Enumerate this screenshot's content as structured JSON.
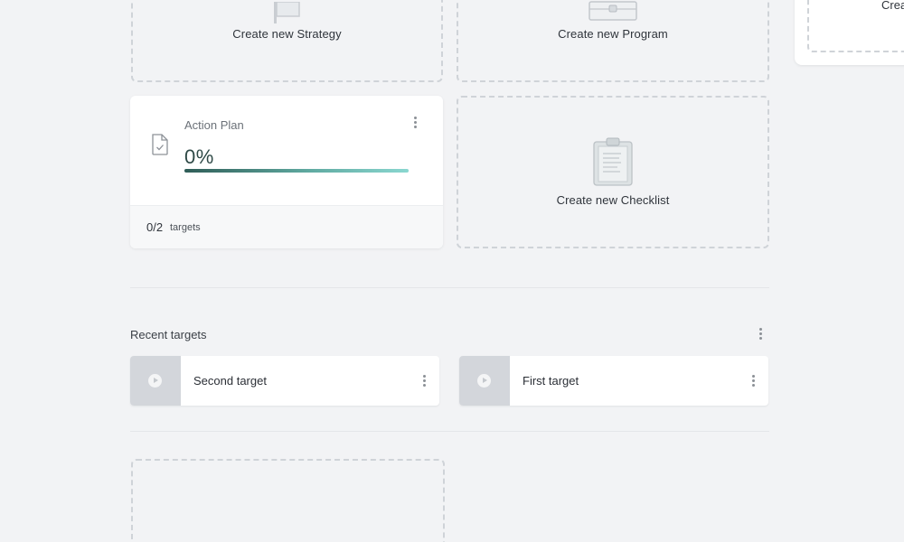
{
  "create_tiles": {
    "strategy": {
      "label": "Create new Strategy",
      "icon": "flag-icon"
    },
    "program": {
      "label": "Create new Program",
      "icon": "briefcase-icon"
    },
    "checklist": {
      "label": "Create new Checklist",
      "icon": "clipboard-icon"
    },
    "partial": {
      "label": "Crea"
    }
  },
  "action_plan": {
    "title": "Action Plan",
    "percent_text": "0%",
    "progress_fraction": 0.0,
    "count": "0/2",
    "count_label": "targets",
    "icon": "document-check-icon"
  },
  "recent_targets": {
    "title": "Recent targets",
    "items": [
      {
        "name": "Second target"
      },
      {
        "name": "First target"
      }
    ]
  },
  "colors": {
    "background": "#f2f3f5",
    "progress_start": "#2f5d57",
    "progress_end": "#8ad7d0",
    "dashed_border": "#cfd3d8"
  }
}
